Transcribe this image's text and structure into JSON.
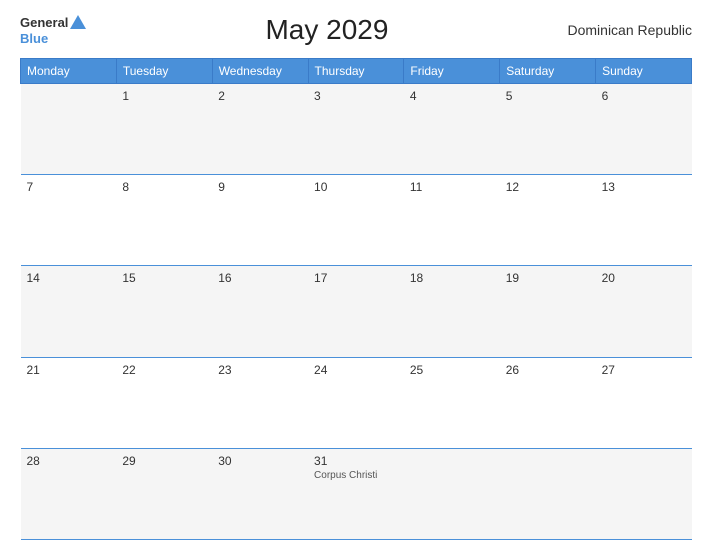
{
  "header": {
    "logo_general": "General",
    "logo_blue": "Blue",
    "title": "May 2029",
    "region": "Dominican Republic"
  },
  "days_of_week": [
    "Monday",
    "Tuesday",
    "Wednesday",
    "Thursday",
    "Friday",
    "Saturday",
    "Sunday"
  ],
  "weeks": [
    [
      {
        "day": "",
        "event": ""
      },
      {
        "day": "1",
        "event": ""
      },
      {
        "day": "2",
        "event": ""
      },
      {
        "day": "3",
        "event": ""
      },
      {
        "day": "4",
        "event": ""
      },
      {
        "day": "5",
        "event": ""
      },
      {
        "day": "6",
        "event": ""
      }
    ],
    [
      {
        "day": "7",
        "event": ""
      },
      {
        "day": "8",
        "event": ""
      },
      {
        "day": "9",
        "event": ""
      },
      {
        "day": "10",
        "event": ""
      },
      {
        "day": "11",
        "event": ""
      },
      {
        "day": "12",
        "event": ""
      },
      {
        "day": "13",
        "event": ""
      }
    ],
    [
      {
        "day": "14",
        "event": ""
      },
      {
        "day": "15",
        "event": ""
      },
      {
        "day": "16",
        "event": ""
      },
      {
        "day": "17",
        "event": ""
      },
      {
        "day": "18",
        "event": ""
      },
      {
        "day": "19",
        "event": ""
      },
      {
        "day": "20",
        "event": ""
      }
    ],
    [
      {
        "day": "21",
        "event": ""
      },
      {
        "day": "22",
        "event": ""
      },
      {
        "day": "23",
        "event": ""
      },
      {
        "day": "24",
        "event": ""
      },
      {
        "day": "25",
        "event": ""
      },
      {
        "day": "26",
        "event": ""
      },
      {
        "day": "27",
        "event": ""
      }
    ],
    [
      {
        "day": "28",
        "event": ""
      },
      {
        "day": "29",
        "event": ""
      },
      {
        "day": "30",
        "event": ""
      },
      {
        "day": "31",
        "event": "Corpus Christi"
      },
      {
        "day": "",
        "event": ""
      },
      {
        "day": "",
        "event": ""
      },
      {
        "day": "",
        "event": ""
      }
    ]
  ]
}
